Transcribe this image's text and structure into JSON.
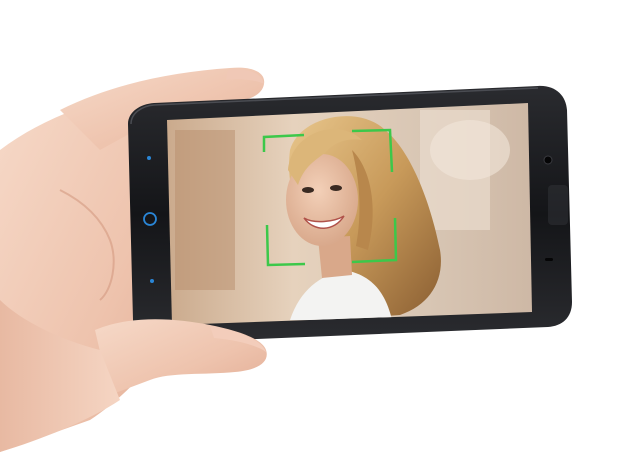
{
  "scene": {
    "subject": "smartphone-held-in-hand",
    "orientation": "landscape",
    "screen_content": "camera-viewfinder-with-face-detection",
    "focus_box_color": "#3cc84a",
    "phone_body_color": "#1c1d20",
    "button_accent_color": "#2a86d6"
  }
}
